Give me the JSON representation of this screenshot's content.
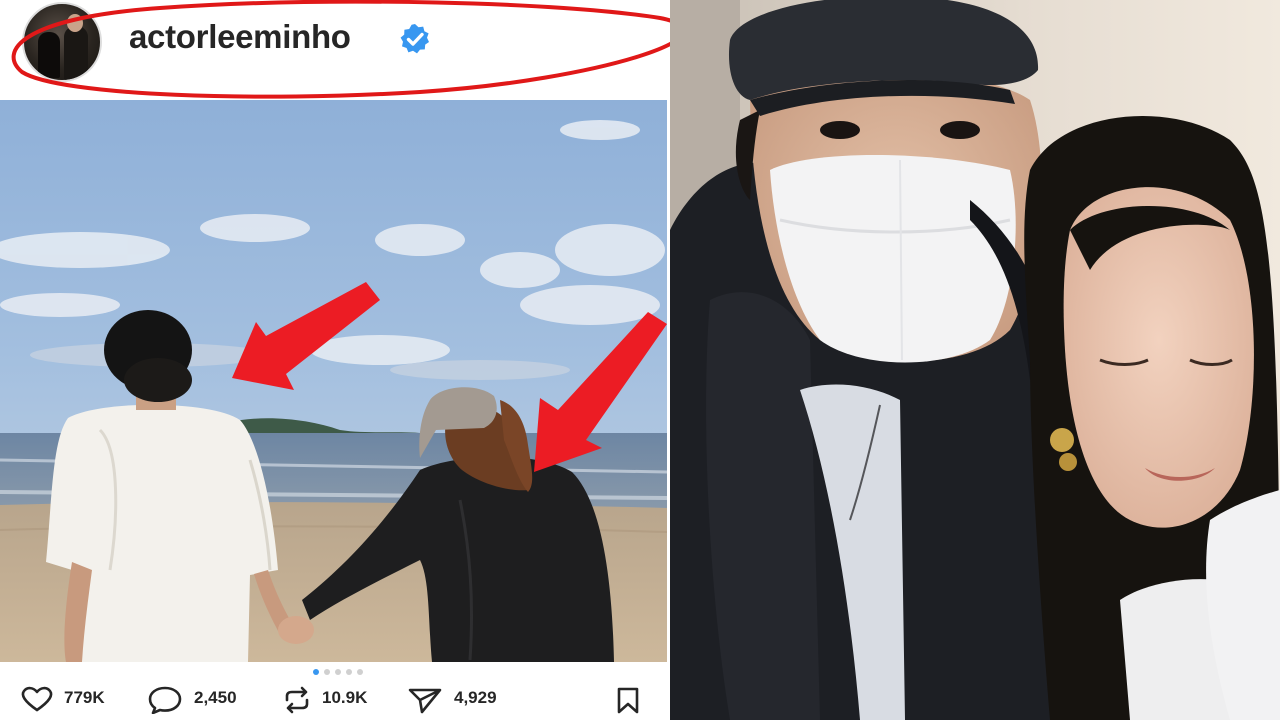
{
  "profile": {
    "username": "actorleeminho",
    "verified": true,
    "highlight_color": "#e01818"
  },
  "post": {
    "arrow_color": "#ec1c24",
    "carousel": {
      "total": 5,
      "current": 1,
      "active_color": "#3897f0"
    },
    "likes": "779K",
    "comments": "2,450",
    "reposts": "10.9K",
    "shares": "4,929"
  },
  "icons": {
    "like": "heart-icon",
    "comment": "comment-bubble-icon",
    "repost": "repost-icon",
    "share": "paper-plane-icon",
    "save": "bookmark-icon",
    "verified": "verified-badge-icon"
  }
}
